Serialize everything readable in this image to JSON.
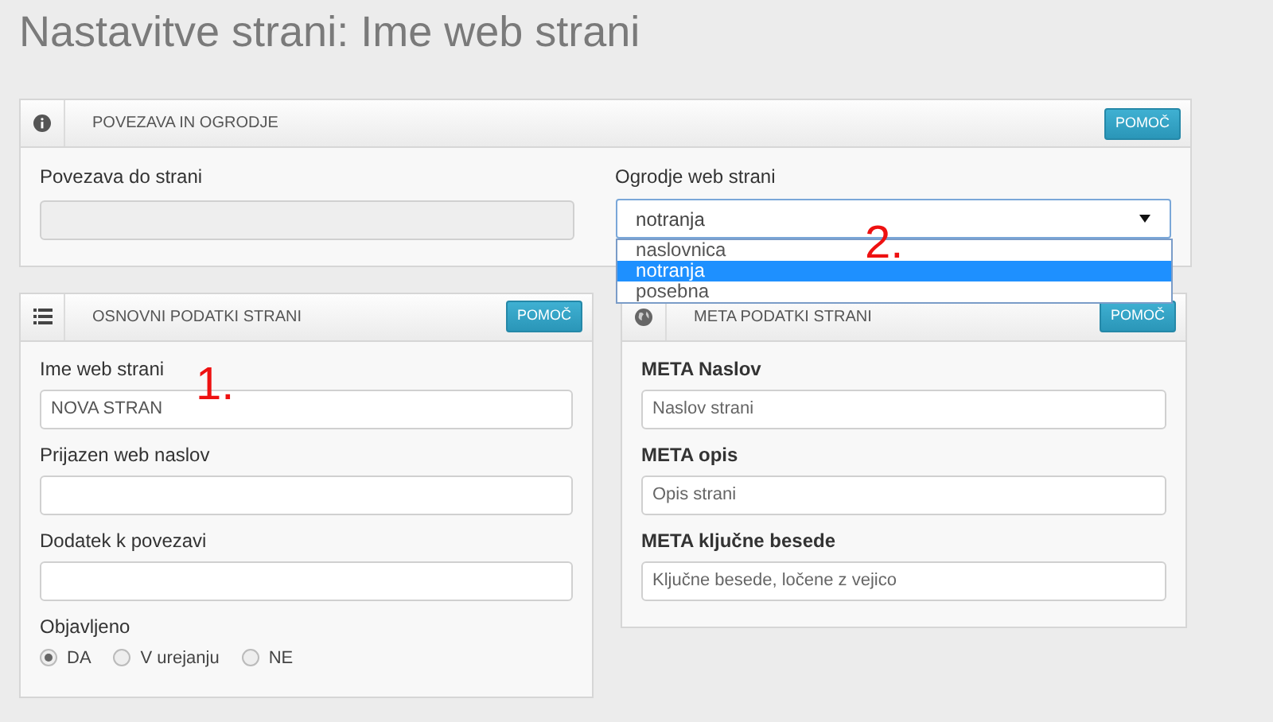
{
  "page_title": "Nastavitve strani: Ime web strani",
  "link_panel": {
    "title": "POVEZAVA IN OGRODJE",
    "help": "POMOČ",
    "link_field": {
      "label": "Povezava do strani",
      "disabled": true
    },
    "template_field": {
      "label": "Ogrodje web strani",
      "value": "notranja",
      "expanded": true,
      "annotation": "2.",
      "options": [
        {
          "label": "naslovnica",
          "selected": false
        },
        {
          "label": "notranja",
          "selected": true
        },
        {
          "label": "posebna",
          "selected": false
        }
      ]
    }
  },
  "basic_panel": {
    "title": "OSNOVNI PODATKI STRANI",
    "help": "POMOČ",
    "annotation": "1.",
    "fields": [
      {
        "label": "Ime web strani",
        "value": "NOVA STRAN"
      },
      {
        "label": "Prijazen web naslov"
      },
      {
        "label": "Dodatek k povezavi"
      }
    ],
    "published": {
      "label": "Objavljeno",
      "options": [
        {
          "label": "DA",
          "selected": true
        },
        {
          "label": "V urejanju",
          "selected": false
        },
        {
          "label": "NE",
          "selected": false
        }
      ]
    }
  },
  "meta_panel": {
    "title": "META PODATKI STRANI",
    "help": "POMOČ",
    "fields": [
      {
        "label": "META Naslov",
        "placeholder": "Naslov strani"
      },
      {
        "label": "META opis",
        "placeholder": "Opis strani"
      },
      {
        "label": "META ključne besede",
        "placeholder": "Ključne besede, ločene z vejico"
      }
    ]
  }
}
